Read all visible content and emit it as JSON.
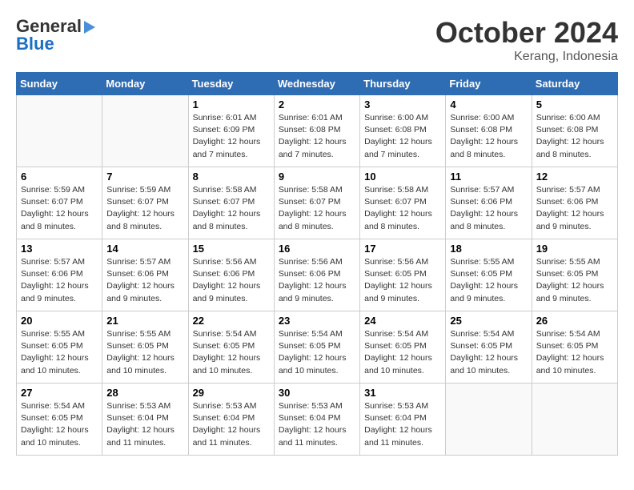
{
  "header": {
    "logo_line1": "General",
    "logo_line2": "Blue",
    "month": "October 2024",
    "location": "Kerang, Indonesia"
  },
  "weekdays": [
    "Sunday",
    "Monday",
    "Tuesday",
    "Wednesday",
    "Thursday",
    "Friday",
    "Saturday"
  ],
  "weeks": [
    [
      {
        "day": "",
        "sunrise": "",
        "sunset": "",
        "daylight": ""
      },
      {
        "day": "",
        "sunrise": "",
        "sunset": "",
        "daylight": ""
      },
      {
        "day": "1",
        "sunrise": "Sunrise: 6:01 AM",
        "sunset": "Sunset: 6:09 PM",
        "daylight": "Daylight: 12 hours and 7 minutes."
      },
      {
        "day": "2",
        "sunrise": "Sunrise: 6:01 AM",
        "sunset": "Sunset: 6:08 PM",
        "daylight": "Daylight: 12 hours and 7 minutes."
      },
      {
        "day": "3",
        "sunrise": "Sunrise: 6:00 AM",
        "sunset": "Sunset: 6:08 PM",
        "daylight": "Daylight: 12 hours and 7 minutes."
      },
      {
        "day": "4",
        "sunrise": "Sunrise: 6:00 AM",
        "sunset": "Sunset: 6:08 PM",
        "daylight": "Daylight: 12 hours and 8 minutes."
      },
      {
        "day": "5",
        "sunrise": "Sunrise: 6:00 AM",
        "sunset": "Sunset: 6:08 PM",
        "daylight": "Daylight: 12 hours and 8 minutes."
      }
    ],
    [
      {
        "day": "6",
        "sunrise": "Sunrise: 5:59 AM",
        "sunset": "Sunset: 6:07 PM",
        "daylight": "Daylight: 12 hours and 8 minutes."
      },
      {
        "day": "7",
        "sunrise": "Sunrise: 5:59 AM",
        "sunset": "Sunset: 6:07 PM",
        "daylight": "Daylight: 12 hours and 8 minutes."
      },
      {
        "day": "8",
        "sunrise": "Sunrise: 5:58 AM",
        "sunset": "Sunset: 6:07 PM",
        "daylight": "Daylight: 12 hours and 8 minutes."
      },
      {
        "day": "9",
        "sunrise": "Sunrise: 5:58 AM",
        "sunset": "Sunset: 6:07 PM",
        "daylight": "Daylight: 12 hours and 8 minutes."
      },
      {
        "day": "10",
        "sunrise": "Sunrise: 5:58 AM",
        "sunset": "Sunset: 6:07 PM",
        "daylight": "Daylight: 12 hours and 8 minutes."
      },
      {
        "day": "11",
        "sunrise": "Sunrise: 5:57 AM",
        "sunset": "Sunset: 6:06 PM",
        "daylight": "Daylight: 12 hours and 8 minutes."
      },
      {
        "day": "12",
        "sunrise": "Sunrise: 5:57 AM",
        "sunset": "Sunset: 6:06 PM",
        "daylight": "Daylight: 12 hours and 9 minutes."
      }
    ],
    [
      {
        "day": "13",
        "sunrise": "Sunrise: 5:57 AM",
        "sunset": "Sunset: 6:06 PM",
        "daylight": "Daylight: 12 hours and 9 minutes."
      },
      {
        "day": "14",
        "sunrise": "Sunrise: 5:57 AM",
        "sunset": "Sunset: 6:06 PM",
        "daylight": "Daylight: 12 hours and 9 minutes."
      },
      {
        "day": "15",
        "sunrise": "Sunrise: 5:56 AM",
        "sunset": "Sunset: 6:06 PM",
        "daylight": "Daylight: 12 hours and 9 minutes."
      },
      {
        "day": "16",
        "sunrise": "Sunrise: 5:56 AM",
        "sunset": "Sunset: 6:06 PM",
        "daylight": "Daylight: 12 hours and 9 minutes."
      },
      {
        "day": "17",
        "sunrise": "Sunrise: 5:56 AM",
        "sunset": "Sunset: 6:05 PM",
        "daylight": "Daylight: 12 hours and 9 minutes."
      },
      {
        "day": "18",
        "sunrise": "Sunrise: 5:55 AM",
        "sunset": "Sunset: 6:05 PM",
        "daylight": "Daylight: 12 hours and 9 minutes."
      },
      {
        "day": "19",
        "sunrise": "Sunrise: 5:55 AM",
        "sunset": "Sunset: 6:05 PM",
        "daylight": "Daylight: 12 hours and 9 minutes."
      }
    ],
    [
      {
        "day": "20",
        "sunrise": "Sunrise: 5:55 AM",
        "sunset": "Sunset: 6:05 PM",
        "daylight": "Daylight: 12 hours and 10 minutes."
      },
      {
        "day": "21",
        "sunrise": "Sunrise: 5:55 AM",
        "sunset": "Sunset: 6:05 PM",
        "daylight": "Daylight: 12 hours and 10 minutes."
      },
      {
        "day": "22",
        "sunrise": "Sunrise: 5:54 AM",
        "sunset": "Sunset: 6:05 PM",
        "daylight": "Daylight: 12 hours and 10 minutes."
      },
      {
        "day": "23",
        "sunrise": "Sunrise: 5:54 AM",
        "sunset": "Sunset: 6:05 PM",
        "daylight": "Daylight: 12 hours and 10 minutes."
      },
      {
        "day": "24",
        "sunrise": "Sunrise: 5:54 AM",
        "sunset": "Sunset: 6:05 PM",
        "daylight": "Daylight: 12 hours and 10 minutes."
      },
      {
        "day": "25",
        "sunrise": "Sunrise: 5:54 AM",
        "sunset": "Sunset: 6:05 PM",
        "daylight": "Daylight: 12 hours and 10 minutes."
      },
      {
        "day": "26",
        "sunrise": "Sunrise: 5:54 AM",
        "sunset": "Sunset: 6:05 PM",
        "daylight": "Daylight: 12 hours and 10 minutes."
      }
    ],
    [
      {
        "day": "27",
        "sunrise": "Sunrise: 5:54 AM",
        "sunset": "Sunset: 6:05 PM",
        "daylight": "Daylight: 12 hours and 10 minutes."
      },
      {
        "day": "28",
        "sunrise": "Sunrise: 5:53 AM",
        "sunset": "Sunset: 6:04 PM",
        "daylight": "Daylight: 12 hours and 11 minutes."
      },
      {
        "day": "29",
        "sunrise": "Sunrise: 5:53 AM",
        "sunset": "Sunset: 6:04 PM",
        "daylight": "Daylight: 12 hours and 11 minutes."
      },
      {
        "day": "30",
        "sunrise": "Sunrise: 5:53 AM",
        "sunset": "Sunset: 6:04 PM",
        "daylight": "Daylight: 12 hours and 11 minutes."
      },
      {
        "day": "31",
        "sunrise": "Sunrise: 5:53 AM",
        "sunset": "Sunset: 6:04 PM",
        "daylight": "Daylight: 12 hours and 11 minutes."
      },
      {
        "day": "",
        "sunrise": "",
        "sunset": "",
        "daylight": ""
      },
      {
        "day": "",
        "sunrise": "",
        "sunset": "",
        "daylight": ""
      }
    ]
  ]
}
